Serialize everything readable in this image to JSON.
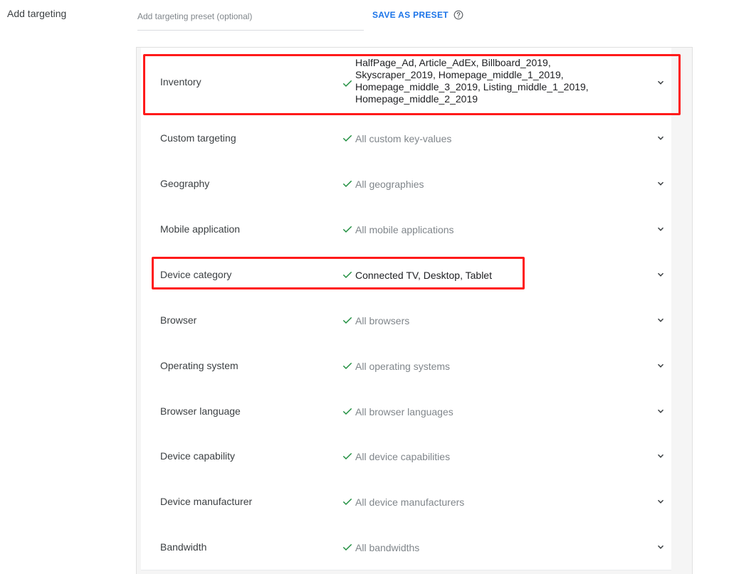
{
  "targeting": {
    "section_label": "Add targeting",
    "preset_placeholder": "Add targeting preset (optional)",
    "preset_value": "",
    "save_as_preset_label": "SAVE AS PRESET",
    "rows": [
      {
        "label": "Inventory",
        "value": "HalfPage_Ad, Article_AdEx, Billboard_2019, Skyscraper_2019, Homepage_middle_1_2019, Homepage_middle_3_2019, Listing_middle_1_2019, Homepage_middle_2_2019",
        "highlighted": true
      },
      {
        "label": "Custom targeting",
        "value": "All custom key-values"
      },
      {
        "label": "Geography",
        "value": "All geographies"
      },
      {
        "label": "Mobile application",
        "value": "All mobile applications"
      },
      {
        "label": "Device category",
        "value": "Connected TV, Desktop, Tablet",
        "highlighted": true
      },
      {
        "label": "Browser",
        "value": "All browsers"
      },
      {
        "label": "Operating system",
        "value": "All operating systems"
      },
      {
        "label": "Browser language",
        "value": "All browser languages"
      },
      {
        "label": "Device capability",
        "value": "All device capabilities"
      },
      {
        "label": "Device manufacturer",
        "value": "All device manufacturers"
      },
      {
        "label": "Bandwidth",
        "value": "All bandwidths"
      }
    ]
  },
  "colors": {
    "accent": "#1a73e8",
    "check": "#1e8e3e",
    "highlight": "#ff1a1a"
  }
}
